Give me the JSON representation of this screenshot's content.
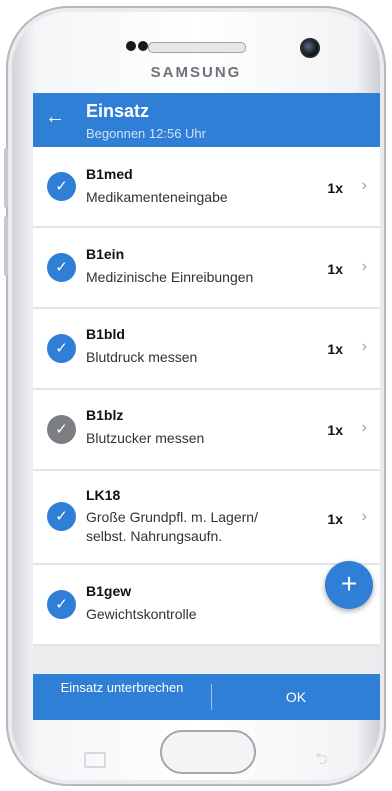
{
  "device": {
    "brand": "SAMSUNG"
  },
  "appbar": {
    "title": "Einsatz",
    "subtitle": "Begonnen 12:56 Uhr",
    "back_icon": "←"
  },
  "items": [
    {
      "code": "B1med",
      "description": "Medikamenteneingabe",
      "count": "1x",
      "status": "checked"
    },
    {
      "code": "B1ein",
      "description": "Medizinische Einreibungen",
      "count": "1x",
      "status": "checked"
    },
    {
      "code": "B1bld",
      "description": "Blutdruck messen",
      "count": "1x",
      "status": "checked"
    },
    {
      "code": "B1blz",
      "description": "Blutzucker messen",
      "count": "1x",
      "status": "unchecked-grey"
    },
    {
      "code": "LK18",
      "description": "Große Grundpfl. m. Lagern/ selbst. Nahrungsaufn.",
      "count": "1x",
      "status": "checked"
    },
    {
      "code": "B1gew",
      "description": "Gewichtskontrolle",
      "count": "",
      "status": "checked"
    }
  ],
  "fab": {
    "label": "+"
  },
  "bottombar": {
    "interrupt_label": "Einsatz unterbrechen",
    "ok_label": "OK"
  },
  "icons": {
    "check": "✓",
    "chevron": "›"
  },
  "colors": {
    "primary": "#2f7fd6",
    "grey_check": "#7b7e82"
  }
}
